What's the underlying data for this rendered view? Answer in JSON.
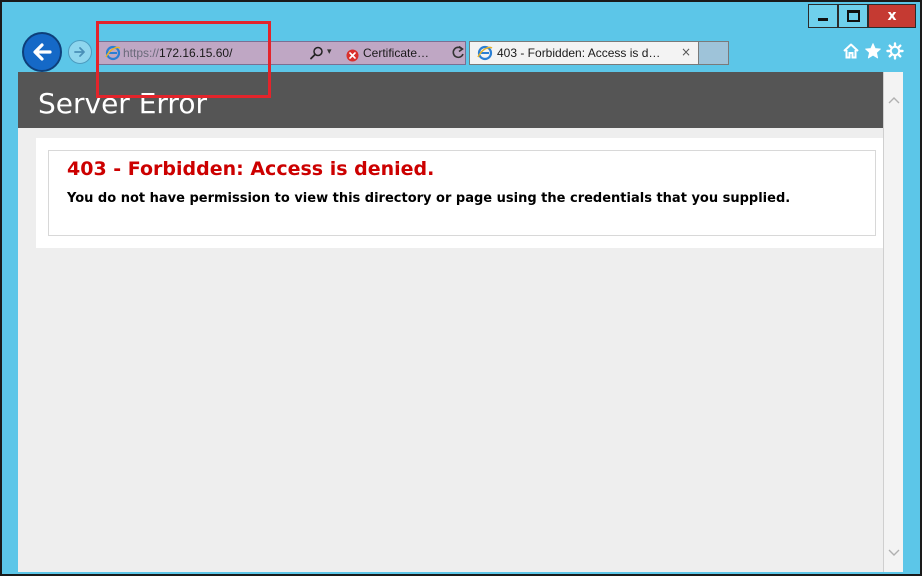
{
  "window": {
    "close_label": "x"
  },
  "addressbar": {
    "url_scheme": "https://",
    "url_host": "172.16.15.60/",
    "certificate_label": "Certificate…"
  },
  "tab": {
    "title": "403 - Forbidden: Access is d…",
    "close_glyph": "×"
  },
  "page": {
    "header_title": "Server Error",
    "error_heading": "403 - Forbidden: Access is denied.",
    "error_message": "You do not have permission to view this directory or page using the credentials that you supplied."
  },
  "icons": {
    "back": "back-arrow-icon",
    "forward": "forward-arrow-icon",
    "ie": "internet-explorer-icon",
    "search": "search-icon",
    "certificate_error": "certificate-error-icon",
    "refresh": "refresh-icon",
    "home": "home-icon",
    "favorites": "star-icon",
    "tools": "gear-icon"
  },
  "colors": {
    "titlebar": "#5cc6e8",
    "close_button": "#c53a32",
    "back_button": "#1569c7",
    "header_bar": "#555555",
    "error_heading": "#cc0000",
    "annotation_box": "#e3242b"
  }
}
